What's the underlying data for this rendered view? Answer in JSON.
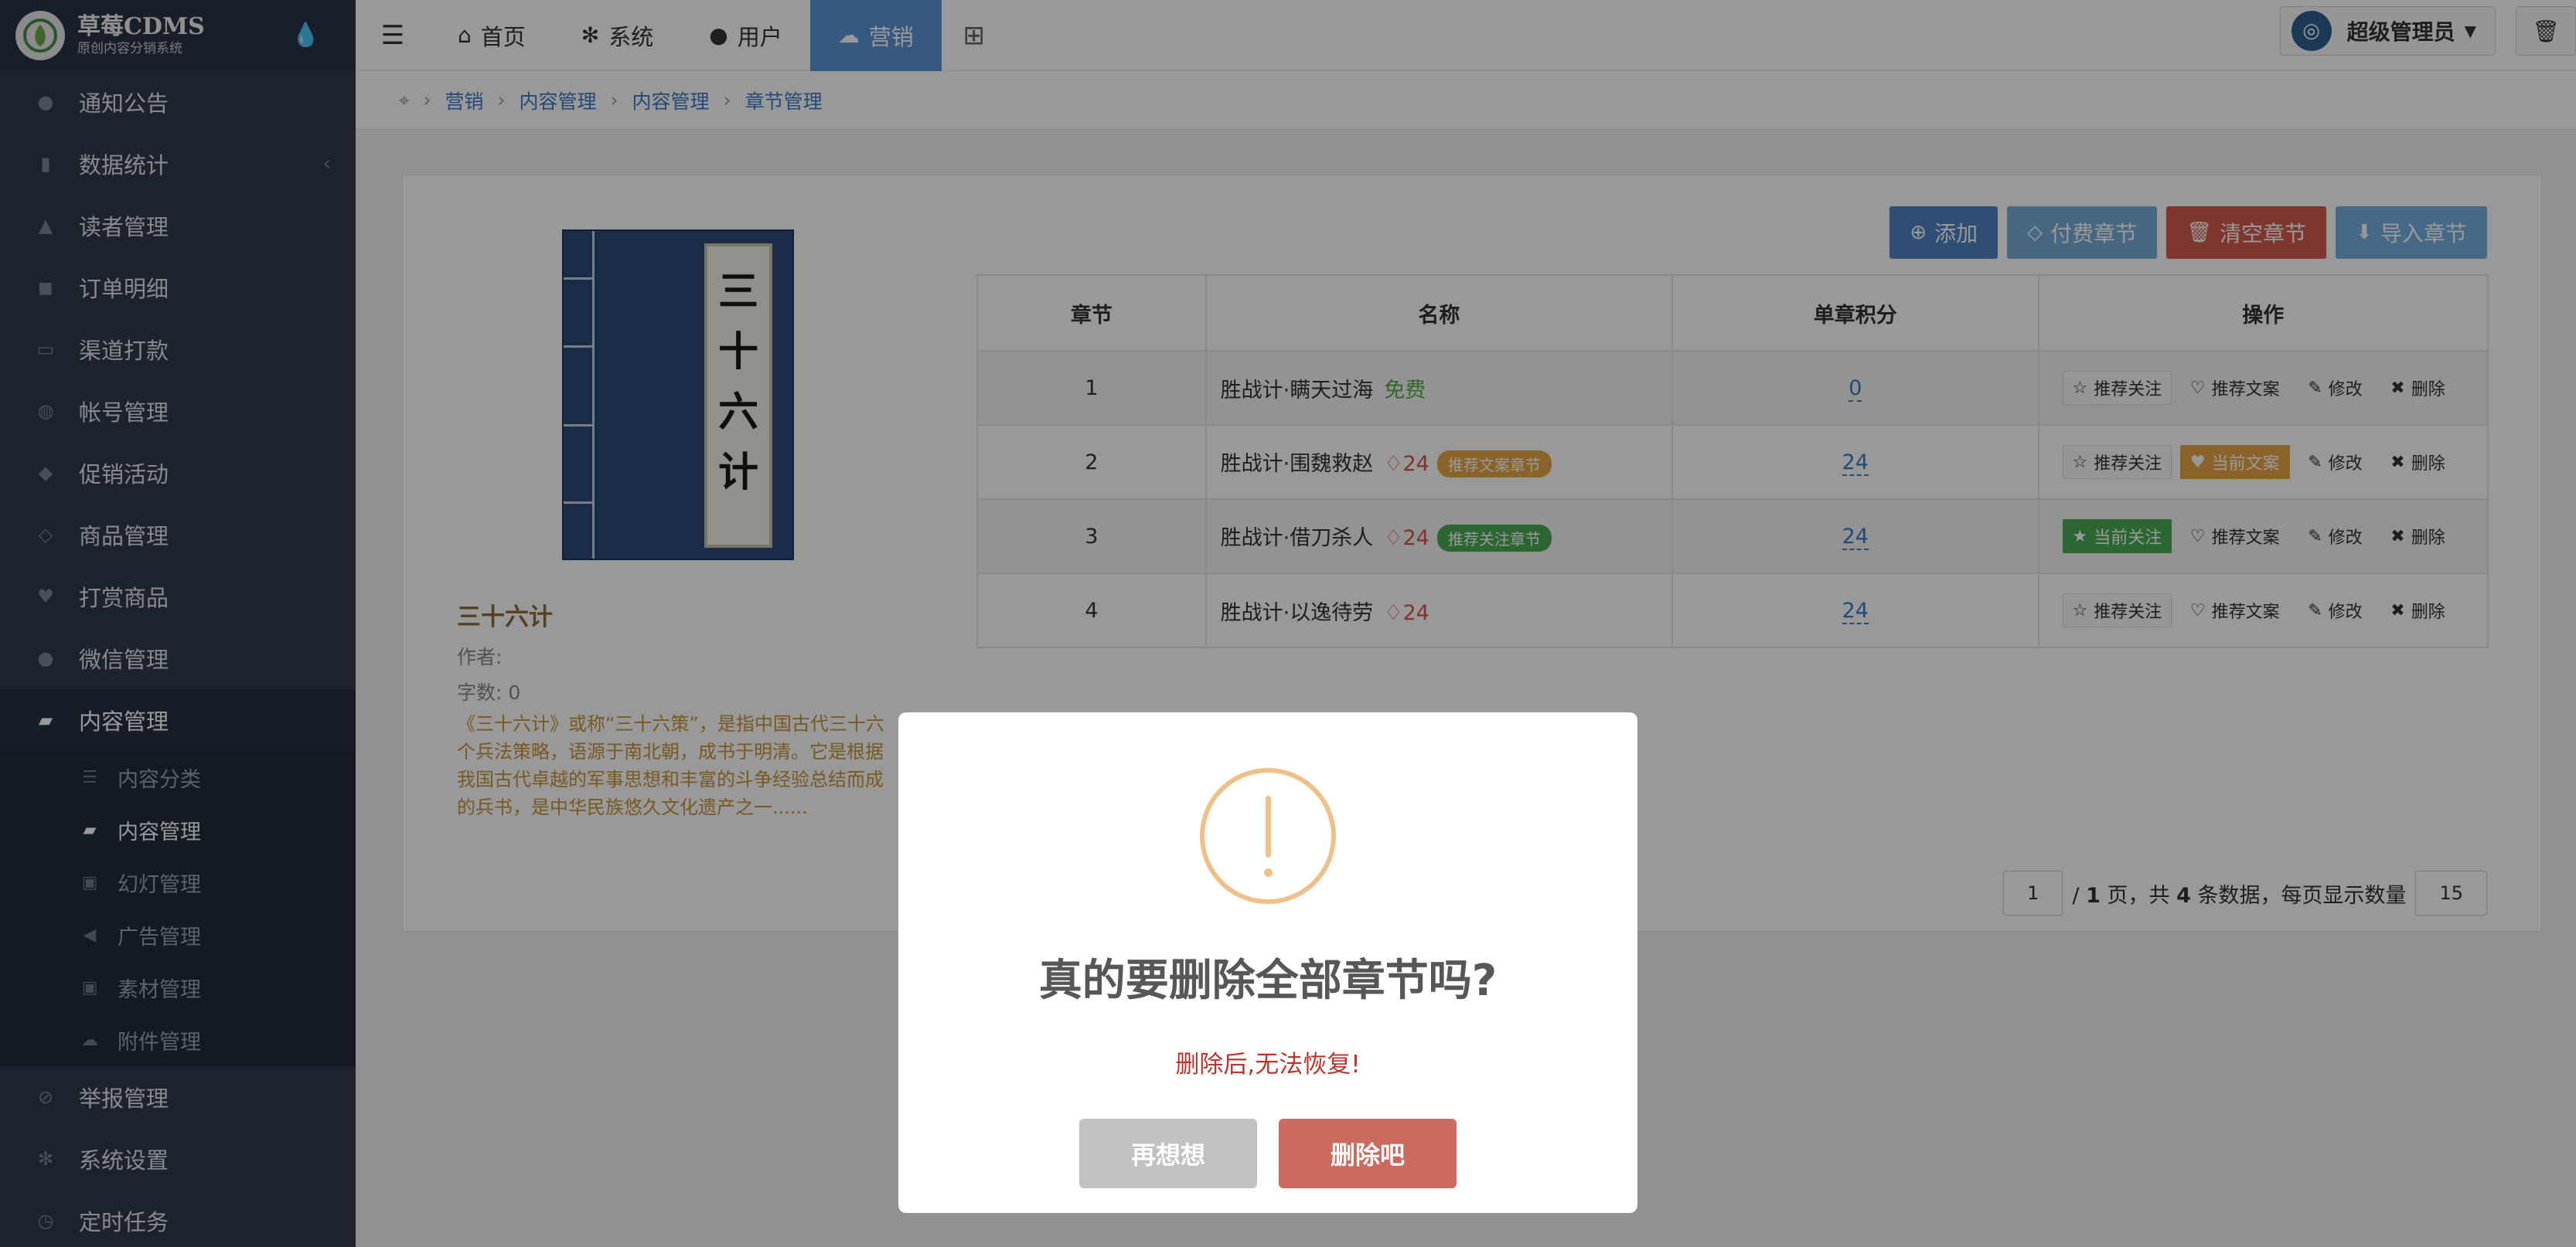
{
  "app": {
    "title": "草莓CDMS",
    "subtitle": "原创内容分销系统"
  },
  "sidebar": {
    "items": [
      {
        "label": "通知公告",
        "icon": "comment-icon"
      },
      {
        "label": "数据统计",
        "icon": "bar-chart-icon"
      },
      {
        "label": "读者管理",
        "icon": "lock-icon"
      },
      {
        "label": "订单明细",
        "icon": "cart-icon"
      },
      {
        "label": "渠道打款",
        "icon": "visa-icon"
      },
      {
        "label": "帐号管理",
        "icon": "user-icon"
      },
      {
        "label": "促销活动",
        "icon": "briefcase-icon"
      },
      {
        "label": "商品管理",
        "icon": "diamond-icon"
      },
      {
        "label": "打赏商品",
        "icon": "heart-icon"
      },
      {
        "label": "微信管理",
        "icon": "wechat-icon"
      },
      {
        "label": "内容管理",
        "icon": "book-icon"
      },
      {
        "label": "举报管理",
        "icon": "ban-icon"
      },
      {
        "label": "系统设置",
        "icon": "gear-icon"
      },
      {
        "label": "定时任务",
        "icon": "clock-icon"
      }
    ],
    "sub_items": [
      {
        "label": "内容分类",
        "icon": "list-icon"
      },
      {
        "label": "内容管理",
        "icon": "book-icon"
      },
      {
        "label": "幻灯管理",
        "icon": "image-icon"
      },
      {
        "label": "广告管理",
        "icon": "bullhorn-icon"
      },
      {
        "label": "素材管理",
        "icon": "picture-icon"
      },
      {
        "label": "附件管理",
        "icon": "cloud-icon"
      }
    ]
  },
  "topbar": {
    "nav": [
      {
        "label": "首页",
        "icon": "home-icon"
      },
      {
        "label": "系统",
        "icon": "gear-icon"
      },
      {
        "label": "用户",
        "icon": "user-icon"
      },
      {
        "label": "营销",
        "icon": "cloud-icon"
      }
    ],
    "user": "超级管理员"
  },
  "breadcrumb": [
    "营销",
    "内容管理",
    "内容管理",
    "章节管理"
  ],
  "book": {
    "cover_text": [
      "三",
      "十",
      "六",
      "计"
    ],
    "title": "三十六计",
    "author_label": "作者:",
    "words_label": "字数: 0",
    "description": "《三十六计》或称“三十六策”，是指中国古代三十六个兵法策略，语源于南北朝，成书于明清。它是根据我国古代卓越的军事思想和丰富的斗争经验总结而成的兵书，是中华民族悠久文化遗产之一......"
  },
  "actions": {
    "add": "添加",
    "paid": "付费章节",
    "clear": "清空章节",
    "import": "导入章节"
  },
  "table": {
    "headers": [
      "章节",
      "名称",
      "单章积分",
      "操作"
    ],
    "rows": [
      {
        "num": "1",
        "name": "胜战计·瞒天过海",
        "price": "免费",
        "points": "0",
        "tag": "",
        "follow": "推荐关注",
        "article": "推荐文案",
        "edit": "修改",
        "delete": "删除"
      },
      {
        "num": "2",
        "name": "胜战计·围魏救赵",
        "price": "24",
        "points": "24",
        "tag": "推荐文案章节",
        "follow": "推荐关注",
        "article": "当前文案",
        "edit": "修改",
        "delete": "删除"
      },
      {
        "num": "3",
        "name": "胜战计·借刀杀人",
        "price": "24",
        "points": "24",
        "tag": "推荐关注章节",
        "follow": "当前关注",
        "article": "推荐文案",
        "edit": "修改",
        "delete": "删除"
      },
      {
        "num": "4",
        "name": "胜战计·以逸待劳",
        "price": "24",
        "points": "24",
        "tag": "",
        "follow": "推荐关注",
        "article": "推荐文案",
        "edit": "修改",
        "delete": "删除"
      }
    ]
  },
  "pager": {
    "page": "1",
    "summary_prefix": "/",
    "total_pages": "1",
    "summary_mid": "页，共",
    "total": "4",
    "summary_suffix": "条数据，每页显示数量",
    "page_size": "15"
  },
  "dialog": {
    "title": "真的要删除全部章节吗?",
    "text": "删除后,无法恢复!",
    "cancel": "再想想",
    "confirm": "删除吧"
  },
  "colors": {
    "sidebar": "#2f3b4c",
    "accent": "#5a94d6",
    "danger": "#d25a4d",
    "warning": "#f0c08a"
  }
}
